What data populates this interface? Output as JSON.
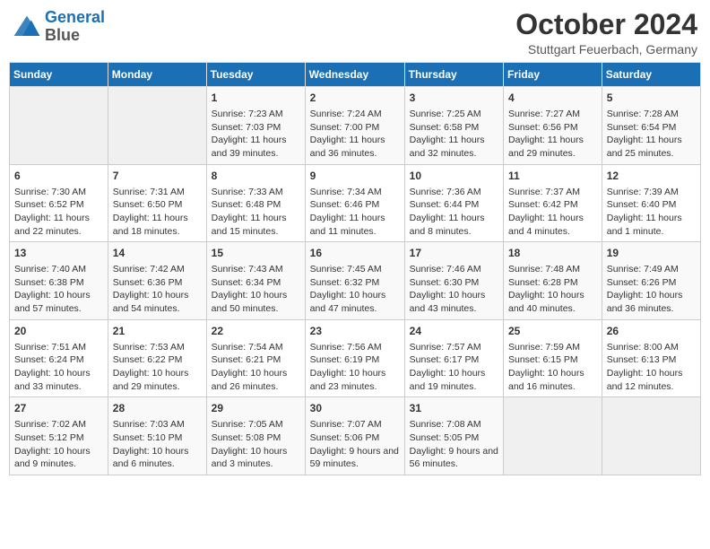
{
  "header": {
    "logo_line1": "General",
    "logo_line2": "Blue",
    "month_title": "October 2024",
    "location": "Stuttgart Feuerbach, Germany"
  },
  "days_of_week": [
    "Sunday",
    "Monday",
    "Tuesday",
    "Wednesday",
    "Thursday",
    "Friday",
    "Saturday"
  ],
  "weeks": [
    [
      {
        "day": "",
        "empty": true
      },
      {
        "day": "",
        "empty": true
      },
      {
        "day": "1",
        "sunrise": "Sunrise: 7:23 AM",
        "sunset": "Sunset: 7:03 PM",
        "daylight": "Daylight: 11 hours and 39 minutes."
      },
      {
        "day": "2",
        "sunrise": "Sunrise: 7:24 AM",
        "sunset": "Sunset: 7:00 PM",
        "daylight": "Daylight: 11 hours and 36 minutes."
      },
      {
        "day": "3",
        "sunrise": "Sunrise: 7:25 AM",
        "sunset": "Sunset: 6:58 PM",
        "daylight": "Daylight: 11 hours and 32 minutes."
      },
      {
        "day": "4",
        "sunrise": "Sunrise: 7:27 AM",
        "sunset": "Sunset: 6:56 PM",
        "daylight": "Daylight: 11 hours and 29 minutes."
      },
      {
        "day": "5",
        "sunrise": "Sunrise: 7:28 AM",
        "sunset": "Sunset: 6:54 PM",
        "daylight": "Daylight: 11 hours and 25 minutes."
      }
    ],
    [
      {
        "day": "6",
        "sunrise": "Sunrise: 7:30 AM",
        "sunset": "Sunset: 6:52 PM",
        "daylight": "Daylight: 11 hours and 22 minutes."
      },
      {
        "day": "7",
        "sunrise": "Sunrise: 7:31 AM",
        "sunset": "Sunset: 6:50 PM",
        "daylight": "Daylight: 11 hours and 18 minutes."
      },
      {
        "day": "8",
        "sunrise": "Sunrise: 7:33 AM",
        "sunset": "Sunset: 6:48 PM",
        "daylight": "Daylight: 11 hours and 15 minutes."
      },
      {
        "day": "9",
        "sunrise": "Sunrise: 7:34 AM",
        "sunset": "Sunset: 6:46 PM",
        "daylight": "Daylight: 11 hours and 11 minutes."
      },
      {
        "day": "10",
        "sunrise": "Sunrise: 7:36 AM",
        "sunset": "Sunset: 6:44 PM",
        "daylight": "Daylight: 11 hours and 8 minutes."
      },
      {
        "day": "11",
        "sunrise": "Sunrise: 7:37 AM",
        "sunset": "Sunset: 6:42 PM",
        "daylight": "Daylight: 11 hours and 4 minutes."
      },
      {
        "day": "12",
        "sunrise": "Sunrise: 7:39 AM",
        "sunset": "Sunset: 6:40 PM",
        "daylight": "Daylight: 11 hours and 1 minute."
      }
    ],
    [
      {
        "day": "13",
        "sunrise": "Sunrise: 7:40 AM",
        "sunset": "Sunset: 6:38 PM",
        "daylight": "Daylight: 10 hours and 57 minutes."
      },
      {
        "day": "14",
        "sunrise": "Sunrise: 7:42 AM",
        "sunset": "Sunset: 6:36 PM",
        "daylight": "Daylight: 10 hours and 54 minutes."
      },
      {
        "day": "15",
        "sunrise": "Sunrise: 7:43 AM",
        "sunset": "Sunset: 6:34 PM",
        "daylight": "Daylight: 10 hours and 50 minutes."
      },
      {
        "day": "16",
        "sunrise": "Sunrise: 7:45 AM",
        "sunset": "Sunset: 6:32 PM",
        "daylight": "Daylight: 10 hours and 47 minutes."
      },
      {
        "day": "17",
        "sunrise": "Sunrise: 7:46 AM",
        "sunset": "Sunset: 6:30 PM",
        "daylight": "Daylight: 10 hours and 43 minutes."
      },
      {
        "day": "18",
        "sunrise": "Sunrise: 7:48 AM",
        "sunset": "Sunset: 6:28 PM",
        "daylight": "Daylight: 10 hours and 40 minutes."
      },
      {
        "day": "19",
        "sunrise": "Sunrise: 7:49 AM",
        "sunset": "Sunset: 6:26 PM",
        "daylight": "Daylight: 10 hours and 36 minutes."
      }
    ],
    [
      {
        "day": "20",
        "sunrise": "Sunrise: 7:51 AM",
        "sunset": "Sunset: 6:24 PM",
        "daylight": "Daylight: 10 hours and 33 minutes."
      },
      {
        "day": "21",
        "sunrise": "Sunrise: 7:53 AM",
        "sunset": "Sunset: 6:22 PM",
        "daylight": "Daylight: 10 hours and 29 minutes."
      },
      {
        "day": "22",
        "sunrise": "Sunrise: 7:54 AM",
        "sunset": "Sunset: 6:21 PM",
        "daylight": "Daylight: 10 hours and 26 minutes."
      },
      {
        "day": "23",
        "sunrise": "Sunrise: 7:56 AM",
        "sunset": "Sunset: 6:19 PM",
        "daylight": "Daylight: 10 hours and 23 minutes."
      },
      {
        "day": "24",
        "sunrise": "Sunrise: 7:57 AM",
        "sunset": "Sunset: 6:17 PM",
        "daylight": "Daylight: 10 hours and 19 minutes."
      },
      {
        "day": "25",
        "sunrise": "Sunrise: 7:59 AM",
        "sunset": "Sunset: 6:15 PM",
        "daylight": "Daylight: 10 hours and 16 minutes."
      },
      {
        "day": "26",
        "sunrise": "Sunrise: 8:00 AM",
        "sunset": "Sunset: 6:13 PM",
        "daylight": "Daylight: 10 hours and 12 minutes."
      }
    ],
    [
      {
        "day": "27",
        "sunrise": "Sunrise: 7:02 AM",
        "sunset": "Sunset: 5:12 PM",
        "daylight": "Daylight: 10 hours and 9 minutes."
      },
      {
        "day": "28",
        "sunrise": "Sunrise: 7:03 AM",
        "sunset": "Sunset: 5:10 PM",
        "daylight": "Daylight: 10 hours and 6 minutes."
      },
      {
        "day": "29",
        "sunrise": "Sunrise: 7:05 AM",
        "sunset": "Sunset: 5:08 PM",
        "daylight": "Daylight: 10 hours and 3 minutes."
      },
      {
        "day": "30",
        "sunrise": "Sunrise: 7:07 AM",
        "sunset": "Sunset: 5:06 PM",
        "daylight": "Daylight: 9 hours and 59 minutes."
      },
      {
        "day": "31",
        "sunrise": "Sunrise: 7:08 AM",
        "sunset": "Sunset: 5:05 PM",
        "daylight": "Daylight: 9 hours and 56 minutes."
      },
      {
        "day": "",
        "empty": true
      },
      {
        "day": "",
        "empty": true
      }
    ]
  ]
}
